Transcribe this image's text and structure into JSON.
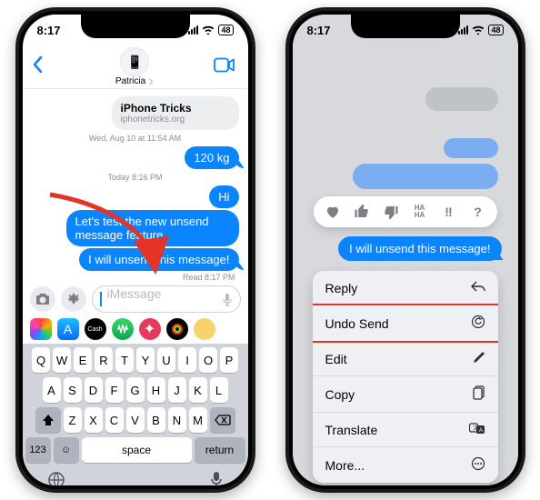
{
  "status": {
    "time": "8:17",
    "battery": "48"
  },
  "left": {
    "contact": "Patricia",
    "link_title": "iPhone Tricks",
    "link_subtitle": "iphonetricks.org",
    "ts1": "Wed, Aug 10 at 11:54 AM",
    "msg1": "120 kg",
    "ts2": "Today 8:16 PM",
    "msg2": "Hi",
    "msg3": "Let's test the new unsend message feature",
    "msg4": "I will unsend this message!",
    "read": "Read 8:17 PM",
    "placeholder": "iMessage",
    "keyboard": {
      "row1": [
        "Q",
        "W",
        "E",
        "R",
        "T",
        "Y",
        "U",
        "I",
        "O",
        "P"
      ],
      "row2": [
        "A",
        "S",
        "D",
        "F",
        "G",
        "H",
        "J",
        "K",
        "L"
      ],
      "row3": [
        "Z",
        "X",
        "C",
        "V",
        "B",
        "N",
        "M"
      ],
      "fn123": "123",
      "space": "space",
      "return": "return"
    }
  },
  "right": {
    "selected_msg": "I will unsend this message!",
    "reactions": {
      "haha": "HA HA",
      "emph": "‼︎",
      "q": "?"
    },
    "menu": {
      "reply": "Reply",
      "undo": "Undo Send",
      "edit": "Edit",
      "copy": "Copy",
      "translate": "Translate",
      "more": "More..."
    }
  }
}
